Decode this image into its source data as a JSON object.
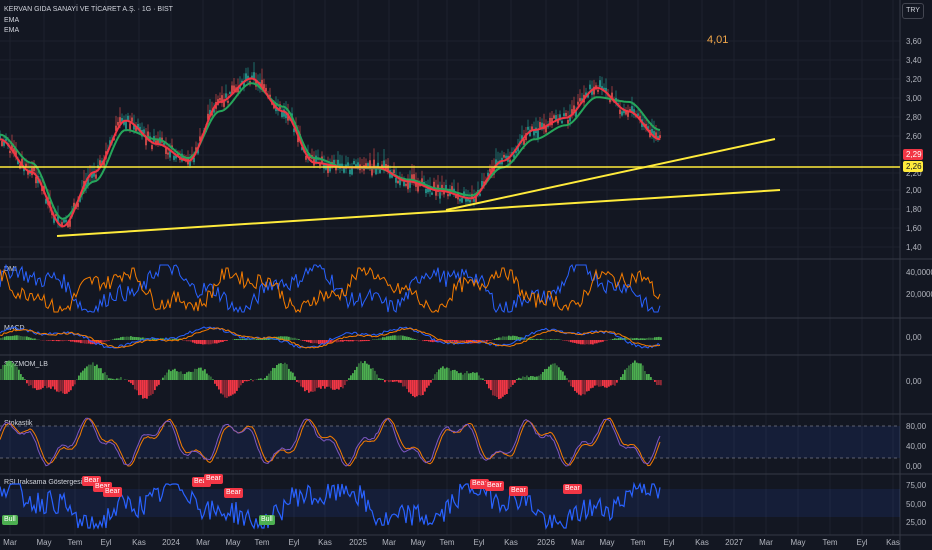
{
  "header": {
    "title": "KERVAN GIDA SANAYİ VE TİCARET A.Ş. · 1G · BIST",
    "ema1": "EMA",
    "ema2": "EMA",
    "currency": "TRY",
    "annotation": "4,01"
  },
  "colors": {
    "background": "#131722",
    "grid": "#1e222d",
    "ema_fast": "#f23645",
    "ema_slow": "#26a65b",
    "trendline": "#ffeb3b",
    "dmi_plus": "#2962ff",
    "dmi_minus": "#f57c00",
    "hist_up": "#4caf50",
    "hist_down": "#f23645",
    "rsi": "#2962ff",
    "stoch": "#7e57c2",
    "bear_badge": "#f23645",
    "bull_badge": "#4caf50"
  },
  "price_axis": {
    "ticks": [
      "3,60",
      "3,40",
      "3,20",
      "3,00",
      "2,80",
      "2,60",
      "2,40",
      "2,20",
      "2,00",
      "1,80",
      "1,60",
      "1,40"
    ],
    "last_price": "2,29",
    "level_price": "2,26"
  },
  "time_axis": {
    "labels": [
      "Mar",
      "May",
      "Tem",
      "Eyl",
      "Kas",
      "2024",
      "Mar",
      "May",
      "Tem",
      "Eyl",
      "Kas",
      "2025",
      "Mar",
      "May",
      "Tem",
      "Eyl",
      "Kas",
      "2026",
      "Mar",
      "May",
      "Tem",
      "Eyl",
      "Kas",
      "2027",
      "Mar",
      "May",
      "Tem",
      "Eyl",
      "Kas"
    ]
  },
  "panes": {
    "dmi": {
      "label": "DMI",
      "ticks": [
        "40,0000",
        "20,0000"
      ]
    },
    "macd": {
      "label": "MACD",
      "ticks": [
        "0,00"
      ]
    },
    "sqz": {
      "label": "SQZMOM_LB",
      "ticks": [
        "0,00"
      ]
    },
    "stoch": {
      "label": "Stokastik",
      "ticks": [
        "80,00",
        "40,00",
        "0,00"
      ]
    },
    "rsi": {
      "label": "RSI Iraksama Göstergesi",
      "ticks": [
        "75,00",
        "50,00",
        "25,00"
      ]
    }
  },
  "badges": [
    {
      "text": "Bull",
      "type": "bull"
    },
    {
      "text": "Bear",
      "type": "bear"
    },
    {
      "text": "Bear",
      "type": "bear"
    },
    {
      "text": "Bear",
      "type": "bear"
    },
    {
      "text": "Bear",
      "type": "bear"
    },
    {
      "text": "Bear",
      "type": "bear"
    },
    {
      "text": "Bear",
      "type": "bear"
    },
    {
      "text": "Bull",
      "type": "bull"
    },
    {
      "text": "Bear",
      "type": "bear"
    },
    {
      "text": "Bear",
      "type": "bear"
    },
    {
      "text": "Bear",
      "type": "bear"
    },
    {
      "text": "Bear",
      "type": "bear"
    }
  ],
  "chart_data": {
    "type": "line",
    "title": "KERVAN GIDA SANAYİ VE TİCARET A.Ş. · 1G · BIST",
    "ylim": [
      1.35,
      3.72
    ],
    "x": [
      "2023-03",
      "2023-05",
      "2023-07",
      "2023-09",
      "2023-11",
      "2024-01",
      "2024-03",
      "2024-05",
      "2024-07",
      "2024-09",
      "2024-11",
      "2025-01",
      "2025-03",
      "2025-05",
      "2025-07",
      "2025-09",
      "2025-11",
      "2026-01",
      "2026-03",
      "2026-05",
      "2026-07",
      "2026-08"
    ],
    "series": [
      {
        "name": "EMA",
        "values": [
          2.55,
          2.2,
          1.62,
          2.2,
          2.75,
          2.5,
          2.32,
          2.95,
          3.2,
          2.85,
          2.3,
          2.25,
          2.25,
          2.1,
          2.0,
          1.92,
          2.32,
          2.65,
          2.78,
          3.1,
          2.85,
          2.55
        ]
      },
      {
        "name": "EMA",
        "values": [
          2.6,
          2.3,
          1.7,
          2.1,
          2.65,
          2.55,
          2.35,
          2.85,
          3.15,
          2.9,
          2.35,
          2.25,
          2.24,
          2.12,
          2.02,
          1.95,
          2.25,
          2.55,
          2.7,
          3.0,
          2.95,
          2.65
        ]
      }
    ],
    "horizontal_line": 2.26,
    "trendlines": [
      {
        "from": [
          "2023-04",
          1.5
        ],
        "to": [
          "2027-03",
          2.0
        ]
      },
      {
        "from": [
          "2025-09",
          1.78
        ],
        "to": [
          "2027-03",
          2.58
        ]
      }
    ]
  }
}
